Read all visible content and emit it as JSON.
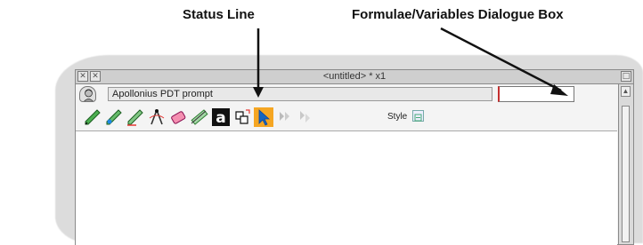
{
  "callouts": {
    "status_line": "Status Line",
    "formulae_box": "Formulae/Variables Dialogue Box"
  },
  "window": {
    "title": "<untitled> * x1",
    "close_icon": "close-icon",
    "iconise_icon": "iconise-icon",
    "toggle_size_icon": "toggle-size-icon"
  },
  "status": {
    "prompt": "Apollonius PDT prompt",
    "logo_icon": "apollonius-portrait-icon"
  },
  "formulae_box": {
    "value": ""
  },
  "toolbar": {
    "tools": [
      "pencil-green-icon",
      "pencil-blue-icon",
      "pencil-line-icon",
      "compass-icon",
      "eraser-icon",
      "ruler-icon",
      "text-a-icon",
      "transform-icon",
      "select-arrow-icon",
      "copy-icon",
      "group-icon"
    ],
    "style_label": "Style"
  },
  "colors": {
    "selected_tool": "#f5a623",
    "formula_accent": "#c53030"
  }
}
